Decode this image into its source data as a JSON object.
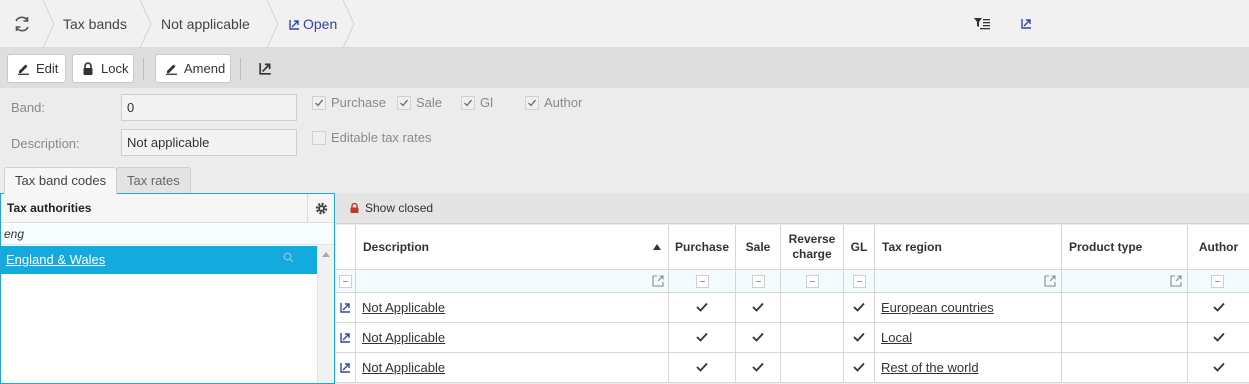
{
  "breadcrumb": {
    "items": [
      "Tax bands",
      "Not applicable",
      "Open"
    ]
  },
  "toolbar": {
    "edit_label": "Edit",
    "lock_label": "Lock",
    "amend_label": "Amend"
  },
  "form": {
    "band_label": "Band:",
    "band_value": "0",
    "description_label": "Description:",
    "description_value": "Not applicable",
    "checkboxes": [
      {
        "label": "Purchase",
        "checked": true
      },
      {
        "label": "Sale",
        "checked": true
      },
      {
        "label": "Gl",
        "checked": true
      },
      {
        "label": "Author",
        "checked": true
      },
      {
        "label": "Editable tax rates",
        "checked": false
      }
    ]
  },
  "tabs": [
    {
      "label": "Tax band codes",
      "active": true
    },
    {
      "label": "Tax rates",
      "active": false
    }
  ],
  "left_panel": {
    "title": "Tax authorities",
    "filter_value": "eng",
    "items": [
      "England & Wales"
    ]
  },
  "grid": {
    "show_closed_label": "Show closed",
    "columns": [
      "Description",
      "Purchase",
      "Sale",
      "Reverse charge",
      "GL",
      "Tax region",
      "Product type",
      "Author"
    ],
    "rows": [
      {
        "description": "Not Applicable",
        "purchase": true,
        "sale": true,
        "reverse_charge": false,
        "gl": true,
        "tax_region": "European countries",
        "product_type": "",
        "author": true
      },
      {
        "description": "Not Applicable",
        "purchase": true,
        "sale": true,
        "reverse_charge": false,
        "gl": true,
        "tax_region": "Local",
        "product_type": "",
        "author": true
      },
      {
        "description": "Not Applicable",
        "purchase": true,
        "sale": true,
        "reverse_charge": false,
        "gl": true,
        "tax_region": "Rest of the world",
        "product_type": "",
        "author": true
      }
    ]
  },
  "colors": {
    "accent": "#13aadd",
    "link": "#3344aa"
  }
}
